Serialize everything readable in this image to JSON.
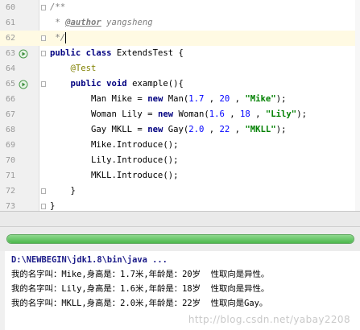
{
  "editor": {
    "lines": [
      {
        "n": "60",
        "parts": [
          [
            "cmt",
            "/**"
          ]
        ]
      },
      {
        "n": "61",
        "parts": [
          [
            "cmt",
            " * "
          ],
          [
            "tag",
            "@author"
          ],
          [
            "cmt",
            " yangsheng"
          ]
        ]
      },
      {
        "n": "62",
        "parts": [
          [
            "cmt",
            " */"
          ]
        ],
        "current": true,
        "caret": true
      },
      {
        "n": "63",
        "run": true,
        "parts": [
          [
            "kw",
            "public class "
          ],
          [
            "txt",
            "ExtendsTest {"
          ]
        ]
      },
      {
        "n": "64",
        "parts": [
          [
            "ann",
            "    @Test"
          ]
        ]
      },
      {
        "n": "65",
        "run": true,
        "parts": [
          [
            "kw",
            "    public void "
          ],
          [
            "txt",
            "example(){"
          ]
        ]
      },
      {
        "n": "66",
        "parts": [
          [
            "txt",
            "        Man Mike = "
          ],
          [
            "kw",
            "new "
          ],
          [
            "txt",
            "Man("
          ],
          [
            "num",
            "1.7"
          ],
          [
            "txt",
            " , "
          ],
          [
            "num",
            "20"
          ],
          [
            "txt",
            " , "
          ],
          [
            "str",
            "\"Mike\""
          ],
          [
            "txt",
            ");"
          ]
        ]
      },
      {
        "n": "67",
        "parts": [
          [
            "txt",
            "        Woman Lily = "
          ],
          [
            "kw",
            "new "
          ],
          [
            "txt",
            "Woman("
          ],
          [
            "num",
            "1.6"
          ],
          [
            "txt",
            " , "
          ],
          [
            "num",
            "18"
          ],
          [
            "txt",
            " , "
          ],
          [
            "str",
            "\"Lily\""
          ],
          [
            "txt",
            ");"
          ]
        ]
      },
      {
        "n": "68",
        "parts": [
          [
            "txt",
            "        Gay MKLL = "
          ],
          [
            "kw",
            "new "
          ],
          [
            "txt",
            "Gay("
          ],
          [
            "num",
            "2.0"
          ],
          [
            "txt",
            " , "
          ],
          [
            "num",
            "22"
          ],
          [
            "txt",
            " , "
          ],
          [
            "str",
            "\"MKLL\""
          ],
          [
            "txt",
            ");"
          ]
        ]
      },
      {
        "n": "69",
        "parts": [
          [
            "txt",
            "        Mike.Introduce();"
          ]
        ]
      },
      {
        "n": "70",
        "parts": [
          [
            "txt",
            "        Lily.Introduce();"
          ]
        ]
      },
      {
        "n": "71",
        "parts": [
          [
            "txt",
            "        MKLL.Introduce();"
          ]
        ]
      },
      {
        "n": "72",
        "parts": [
          [
            "txt",
            "    }"
          ]
        ]
      },
      {
        "n": "73",
        "parts": [
          [
            "txt",
            "}"
          ]
        ]
      }
    ]
  },
  "progress": {
    "fraction": 1.0,
    "color": "#4cb84c"
  },
  "console": {
    "command": "D:\\NEWBEGIN\\jdk1.8\\bin\\java ...",
    "output": [
      "我的名字叫：Mike,身高是：1.7米,年龄是：20岁  性取向是异性。",
      "我的名字叫：Lily,身高是：1.6米,年龄是：18岁  性取向是异性。",
      "我的名字叫：MKLL,身高是：2.0米,年龄是：22岁  性取向是Gay。"
    ]
  },
  "watermark": "http://blog.csdn.net/yabay2208"
}
